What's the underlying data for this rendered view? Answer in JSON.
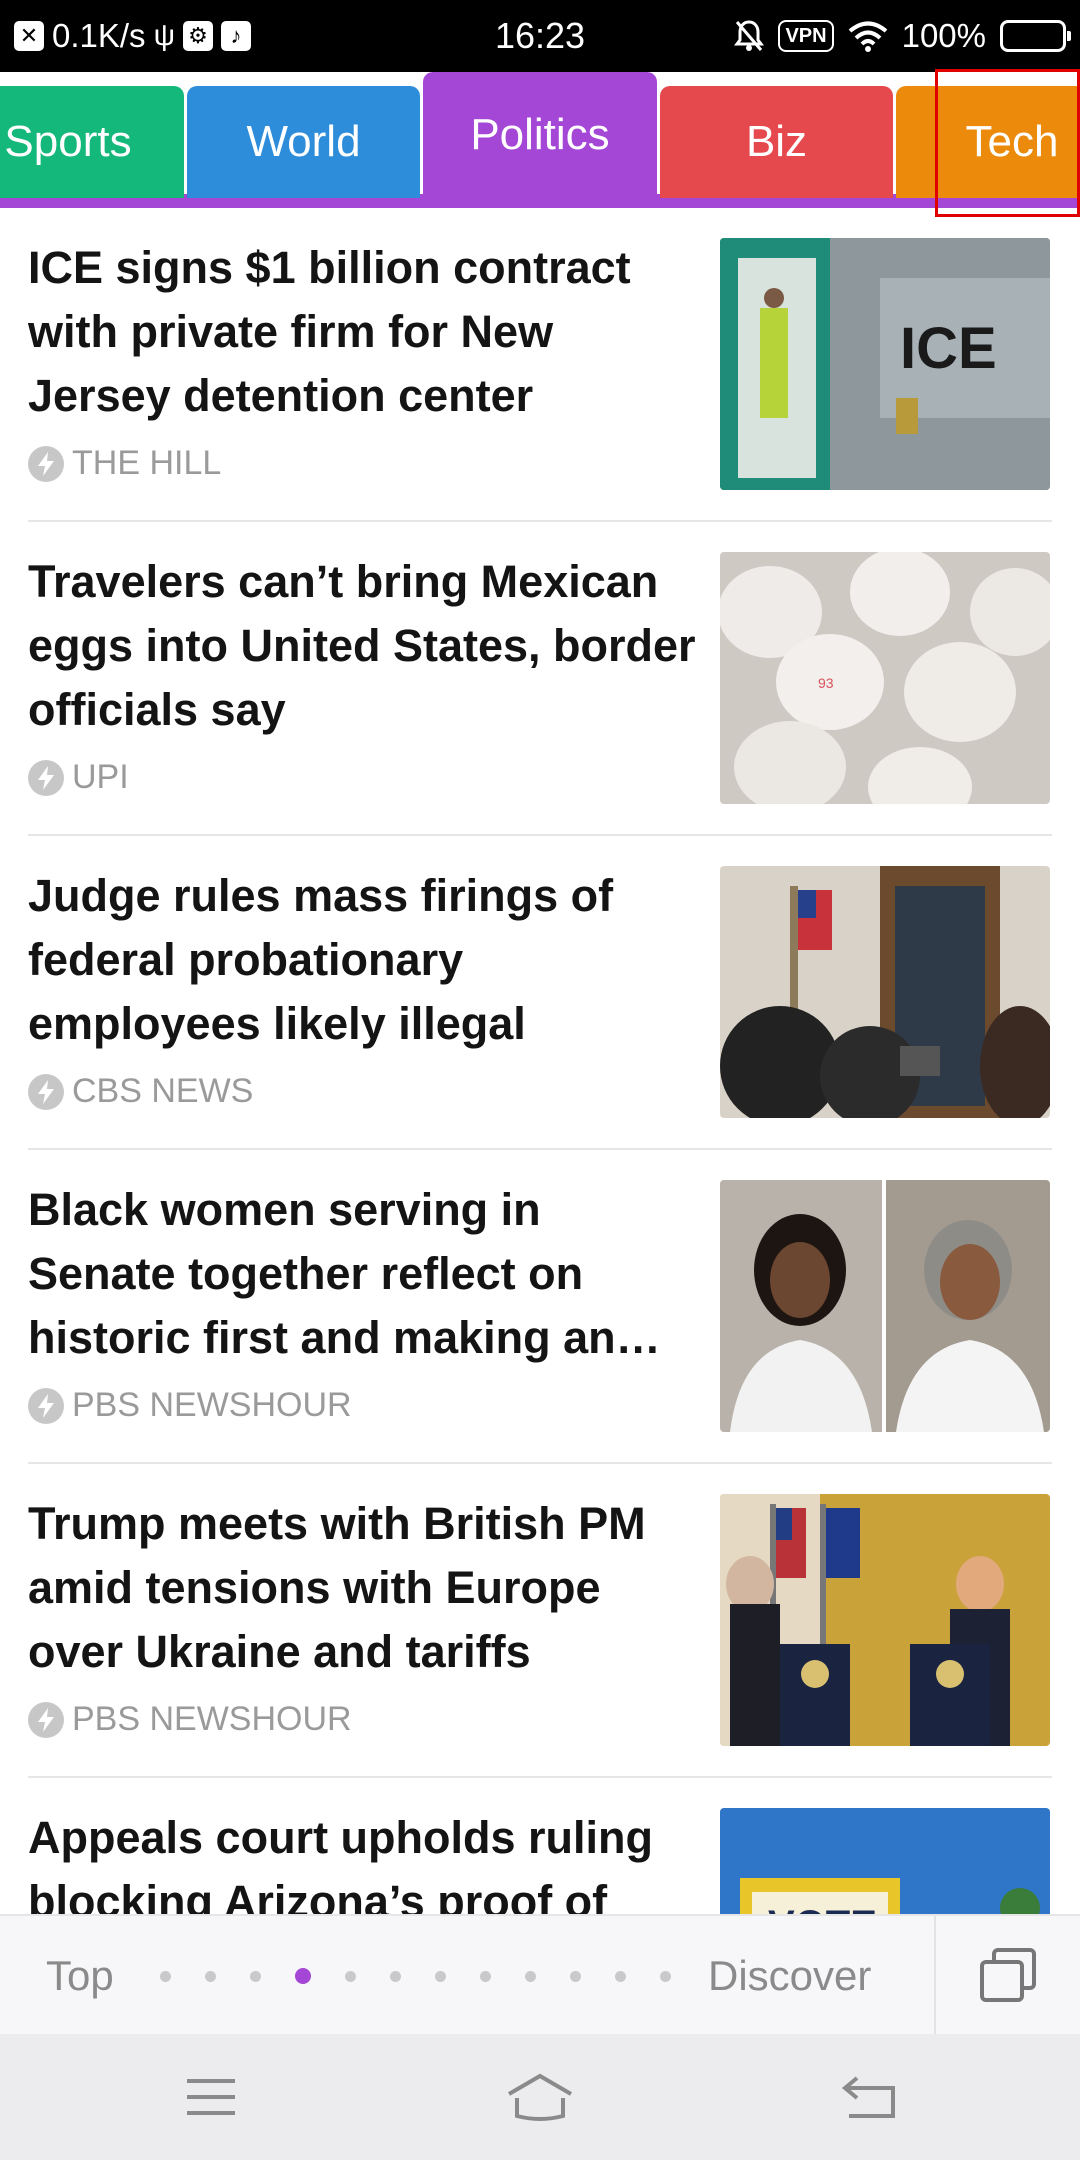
{
  "status_bar": {
    "speed": "0.1K/s",
    "time": "16:23",
    "vpn": "VPN",
    "battery": "100%"
  },
  "tabs": [
    {
      "label": "Sports",
      "color": "#14b87a"
    },
    {
      "label": "World",
      "color": "#2e8ddb"
    },
    {
      "label": "Politics",
      "color": "#a447d6"
    },
    {
      "label": "Biz",
      "color": "#e5484d"
    },
    {
      "label": "Tech",
      "color": "#ec8a0c"
    }
  ],
  "active_tab": "Politics",
  "articles": [
    {
      "headline": "ICE signs $1 billion contract with private firm for New Jersey detention center",
      "source": "THE HILL"
    },
    {
      "headline": "Travelers can’t bring Mexican eggs into United States, border officials say",
      "source": "UPI"
    },
    {
      "headline": "Judge rules mass firings of federal probationary employees likely illegal",
      "source": "CBS NEWS"
    },
    {
      "headline": "Black women serving in Senate together reflect on historic first and making an…",
      "source": "PBS NEWSHOUR"
    },
    {
      "headline": "Trump meets with British PM amid tensions with Europe over Ukraine and tariffs",
      "source": "PBS NEWSHOUR"
    },
    {
      "headline": "Appeals court upholds ruling blocking Arizona’s proof of",
      "source": ""
    }
  ],
  "thumb_texts": {
    "ice": "ICE",
    "vote": "VOTE",
    "egg_stamp": "93"
  },
  "bottom_bar": {
    "top_label": "Top",
    "discover_label": "Discover",
    "page_dots": 12,
    "active_dot": 4
  }
}
